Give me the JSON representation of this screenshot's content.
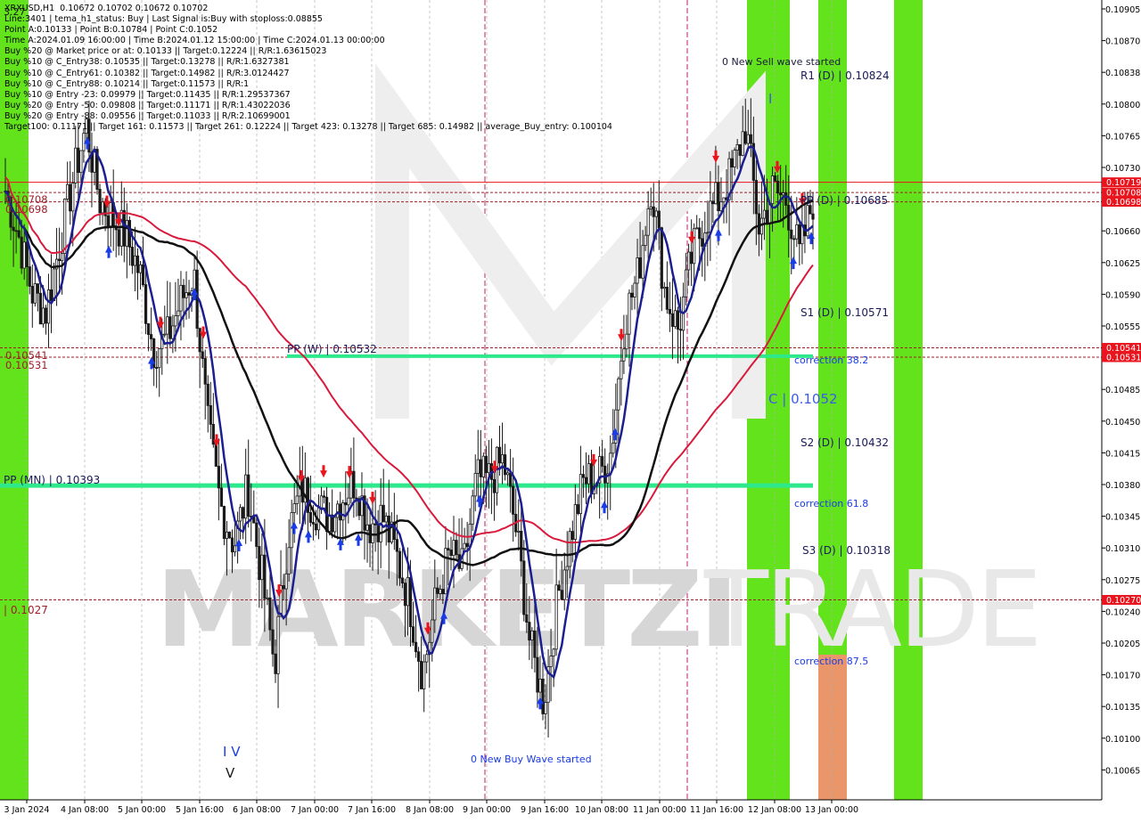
{
  "header": {
    "symbol_line": "XRXUSD,H1  0.10672 0.10702 0.10672 0.10702",
    "info_lines": [
      "Line:3401 | tema_h1_status: Buy | Last Signal is:Buy with stoploss:0.08855",
      "Point A:0.10133 | Point B:0.10784 | Point C:0.1052",
      "Time A:2024.01.09 16:00:00 | Time B:2024.01.12 15:00:00 | Time C:2024.01.13 00:00:00",
      "Buy %20 @ Market price or at: 0.10133 || Target:0.12224 || R/R:1.63615023",
      "Buy %10 @ C_Entry38: 0.10535 || Target:0.13278 || R/R:1.6327381",
      "Buy %10 @ C_Entry61: 0.10382 || Target:0.14982 || R/R:3.0124427",
      "Buy %10 @ C_Entry88: 0.10214 || Target:0.11573 || R/R:1",
      "Buy %10 @ Entry -23: 0.09979 || Target:0.11435 || R/R:1.29537367",
      "Buy %20 @ Entry -50: 0.09808 || Target:0.11171 || R/R:1.43022036",
      "Buy %20 @ Entry -88: 0.09556 || Target:0.11033 || R/R:2.10699001",
      "Target100: 0.11171 || Target 161: 0.11573 || Target 261: 0.12224 || Target 423: 0.13278 || Target 685: 0.14982 || average_Buy_entry: 0.100104"
    ],
    "top_left_marker": "3.27"
  },
  "price_axis": {
    "ticks": [
      "0.10905",
      "0.10870",
      "0.10838",
      "0.10800",
      "0.10765",
      "0.10730",
      "0.10695",
      "0.10660",
      "0.10625",
      "0.10590",
      "0.10555",
      "0.10520",
      "0.10485",
      "0.10450",
      "0.10415",
      "0.10380",
      "0.10345",
      "0.10310",
      "0.10275",
      "0.10240",
      "0.10205",
      "0.10170",
      "0.10135",
      "0.10100",
      "0.10065"
    ],
    "highlighted_labels": [
      {
        "text": "0.10719",
        "color": "#e8141e"
      },
      {
        "text": "0.10708",
        "color": "#e8141e"
      },
      {
        "text": "0.10698",
        "color": "#e8141e"
      },
      {
        "text": "0.10541",
        "color": "#e8141e"
      },
      {
        "text": "0.10531",
        "color": "#e8141e"
      },
      {
        "text": "0.10270",
        "color": "#e8141e"
      }
    ]
  },
  "time_axis": {
    "ticks": [
      "3 Jan 2024",
      "4 Jan 08:00",
      "5 Jan 00:00",
      "5 Jan 16:00",
      "6 Jan 08:00",
      "7 Jan 00:00",
      "7 Jan 16:00",
      "8 Jan 08:00",
      "9 Jan 00:00",
      "9 Jan 16:00",
      "10 Jan 08:00",
      "11 Jan 00:00",
      "11 Jan 16:00",
      "12 Jan 08:00",
      "13 Jan 00:00"
    ]
  },
  "annotations": {
    "r1": "R1 (D) | 0.10824",
    "pp_d": "PP (D) | 0.10685",
    "s1": "S1 (D) | 0.10571",
    "s2": "S2 (D) | 0.10432",
    "s3": "S3 (D) | 0.10318",
    "pp_w": "PP (W) | 0.10532",
    "pp_mn": "PP (MN) | 0.10393",
    "left_level_1": "0.10708",
    "left_level_2": "0.10698",
    "left_level_3": "0.10541",
    "left_level_4": "0.10531",
    "left_level_5": "| 0.1027",
    "corr_38": "correction 38.2",
    "corr_61": "correction 61.8",
    "corr_87": "correction 87.5",
    "sell_wave": "0 New Sell wave started",
    "buy_wave": "0 New Buy Wave started",
    "wave_c_label": "C | 0.1052",
    "wave_b_label": "I",
    "wave_iv_label": "I V",
    "wave_v_label": "V",
    "watermark": "MARKETZITRADE"
  },
  "chart_data": {
    "type": "candlestick",
    "symbol": "XRXUSD",
    "timeframe": "H1",
    "ohlc_last": {
      "open": 0.10672,
      "high": 0.10702,
      "low": 0.10672,
      "close": 0.10702
    },
    "y_range": [
      0.10055,
      0.10915
    ],
    "horizontal_levels": [
      {
        "value": 0.10719,
        "style": "solid",
        "color": "#e8141e"
      },
      {
        "value": 0.10708,
        "style": "dashed",
        "color": "#a01e28"
      },
      {
        "value": 0.10698,
        "style": "dashed",
        "color": "#a01e28"
      },
      {
        "value": 0.10541,
        "style": "dashed",
        "color": "#a01e28"
      },
      {
        "value": 0.10531,
        "style": "dashed",
        "color": "#a01e28"
      },
      {
        "value": 0.1027,
        "style": "dashed",
        "color": "#a01e28"
      }
    ],
    "pivot_lines": [
      {
        "name": "PP (W)",
        "value": 0.10532,
        "color": "#2ee88c"
      },
      {
        "name": "PP (MN)",
        "value": 0.10393,
        "color": "#2ee88c"
      }
    ],
    "close_path": [
      0.1071,
      0.1066,
      0.106,
      0.1058,
      0.1065,
      0.1072,
      0.1078,
      0.107,
      0.1068,
      0.1066,
      0.1062,
      0.1054,
      0.1055,
      0.1059,
      0.1062,
      0.1046,
      0.1037,
      0.1033,
      0.1039,
      0.103,
      0.102,
      0.1034,
      0.1039,
      0.1037,
      0.1036,
      0.1038,
      0.104,
      0.1035,
      0.1036,
      0.1032,
      0.1027,
      0.1019,
      0.1027,
      0.1032,
      0.103,
      0.104,
      0.104,
      0.1042,
      0.1034,
      0.1022,
      0.1016,
      0.1027,
      0.1034,
      0.104,
      0.104,
      0.1043,
      0.1057,
      0.1062,
      0.1072,
      0.106,
      0.1056,
      0.1064,
      0.1068,
      0.107,
      0.1073,
      0.1078,
      0.1067,
      0.1071,
      0.107,
      0.1064,
      0.107
    ]
  }
}
